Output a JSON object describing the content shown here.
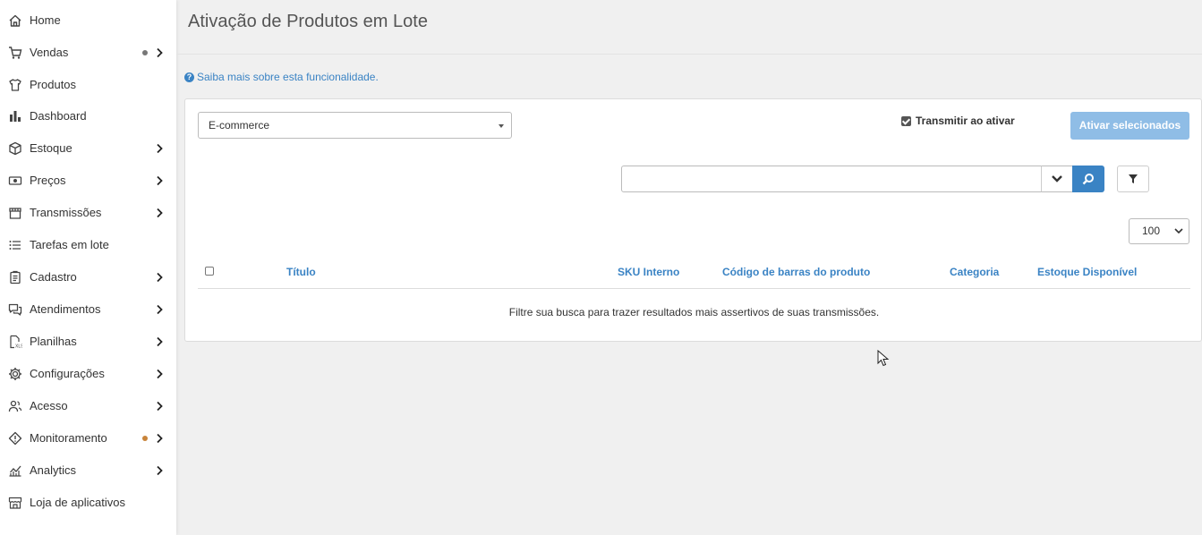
{
  "sidebar": {
    "items": [
      {
        "label": "Home",
        "icon": "home-icon",
        "has_chevron": false,
        "dot_color": ""
      },
      {
        "label": "Vendas",
        "icon": "cart-icon",
        "has_chevron": true,
        "dot_color": "#777777"
      },
      {
        "label": "Produtos",
        "icon": "shirt-icon",
        "has_chevron": false,
        "dot_color": ""
      },
      {
        "label": "Dashboard",
        "icon": "bar-chart-icon",
        "has_chevron": false,
        "dot_color": ""
      },
      {
        "label": "Estoque",
        "icon": "box-icon",
        "has_chevron": true,
        "dot_color": ""
      },
      {
        "label": "Preços",
        "icon": "money-icon",
        "has_chevron": true,
        "dot_color": ""
      },
      {
        "label": "Transmissões",
        "icon": "store-icon",
        "has_chevron": true,
        "dot_color": ""
      },
      {
        "label": "Tarefas em lote",
        "icon": "list-icon",
        "has_chevron": false,
        "dot_color": ""
      },
      {
        "label": "Cadastro",
        "icon": "clipboard-icon",
        "has_chevron": true,
        "dot_color": ""
      },
      {
        "label": "Atendimentos",
        "icon": "chat-icon",
        "has_chevron": true,
        "dot_color": ""
      },
      {
        "label": "Planilhas",
        "icon": "spreadsheet-icon",
        "has_chevron": true,
        "dot_color": ""
      },
      {
        "label": "Configurações",
        "icon": "gear-icon",
        "has_chevron": true,
        "dot_color": ""
      },
      {
        "label": "Acesso",
        "icon": "users-icon",
        "has_chevron": true,
        "dot_color": ""
      },
      {
        "label": "Monitoramento",
        "icon": "diamond-alert-icon",
        "has_chevron": true,
        "dot_color": "#c8843a"
      },
      {
        "label": "Analytics",
        "icon": "analytics-icon",
        "has_chevron": true,
        "dot_color": ""
      },
      {
        "label": "Loja de aplicativos",
        "icon": "shop-icon",
        "has_chevron": false,
        "dot_color": ""
      }
    ]
  },
  "header": {
    "title": "Ativação de Produtos em Lote"
  },
  "help": {
    "label": "Saiba mais sobre esta funcionalidade."
  },
  "filters": {
    "channel_select": "E-commerce",
    "transmit_label": "Transmitir ao ativar",
    "transmit_checked": true,
    "activate_button": "Ativar selecionados",
    "search_value": "",
    "page_size": "100"
  },
  "table": {
    "columns": [
      "Título",
      "SKU Interno",
      "Código de barras do produto",
      "Categoria",
      "Estoque Disponível"
    ],
    "empty_message": "Filtre sua busca para trazer resultados mais assertivos de suas transmissões."
  },
  "colors": {
    "accent": "#3a83c4",
    "button_disabled": "#8fbde6"
  }
}
